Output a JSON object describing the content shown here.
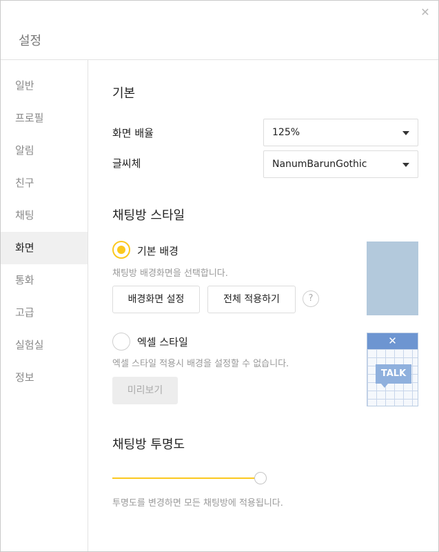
{
  "window": {
    "title": "설정",
    "close_glyph": "✕"
  },
  "sidebar": {
    "items": [
      {
        "label": "일반"
      },
      {
        "label": "프로필"
      },
      {
        "label": "알림"
      },
      {
        "label": "친구"
      },
      {
        "label": "채팅"
      },
      {
        "label": "화면",
        "active": true
      },
      {
        "label": "통화"
      },
      {
        "label": "고급"
      },
      {
        "label": "실험실"
      },
      {
        "label": "정보"
      }
    ]
  },
  "basic": {
    "title": "기본",
    "zoom": {
      "label": "화면 배율",
      "value": "125%"
    },
    "font": {
      "label": "글씨체",
      "value": "NanumBarunGothic"
    }
  },
  "chat_style": {
    "title": "채팅방 스타일",
    "default_bg": {
      "label": "기본 배경",
      "selected": true,
      "description": "채팅방 배경화면을 선택합니다.",
      "set_bg_button": "배경화면 설정",
      "apply_all_button": "전체 적용하기",
      "help_glyph": "?",
      "preview_color": "#b3c9dc"
    },
    "excel": {
      "label": "엑셀 스타일",
      "selected": false,
      "description": "엑셀 스타일 적용시 배경을 설정할 수 없습니다.",
      "preview_button": "미리보기",
      "thumb_logo": "✕",
      "thumb_talk": "TALK"
    }
  },
  "transparency": {
    "title": "채팅방 투명도",
    "value_percent": 100,
    "description": "투명도를 변경하면 모든 채팅방에 적용됩니다."
  },
  "colors": {
    "accent": "#fbc81e",
    "active_bg": "#f0f0f0"
  }
}
